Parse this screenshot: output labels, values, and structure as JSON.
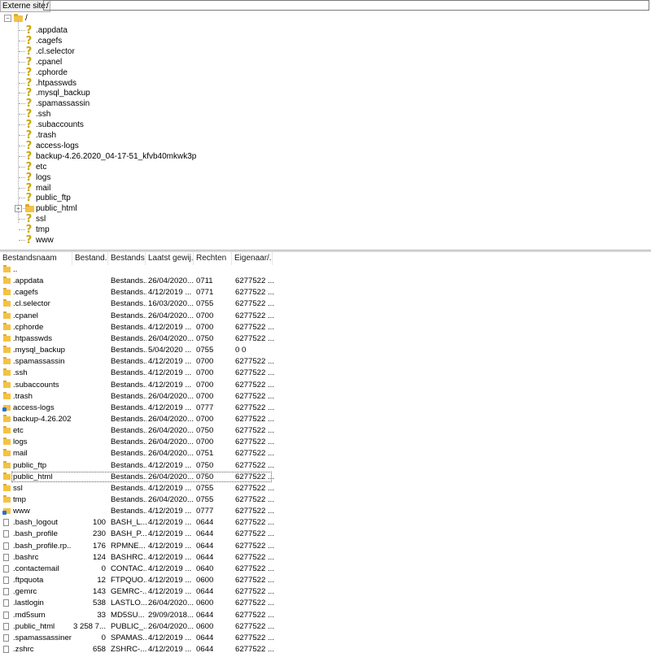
{
  "site_bar": {
    "label": "Externe site:",
    "path": "/"
  },
  "tree": {
    "root": "/",
    "items": [
      {
        "label": ".appdata",
        "icon": "unknown-folder-icon"
      },
      {
        "label": ".cagefs",
        "icon": "unknown-folder-icon"
      },
      {
        "label": ".cl.selector",
        "icon": "unknown-folder-icon"
      },
      {
        "label": ".cpanel",
        "icon": "unknown-folder-icon"
      },
      {
        "label": ".cphorde",
        "icon": "unknown-folder-icon"
      },
      {
        "label": ".htpasswds",
        "icon": "unknown-folder-icon"
      },
      {
        "label": ".mysql_backup",
        "icon": "unknown-folder-icon"
      },
      {
        "label": ".spamassassin",
        "icon": "unknown-folder-icon"
      },
      {
        "label": ".ssh",
        "icon": "unknown-folder-icon"
      },
      {
        "label": ".subaccounts",
        "icon": "unknown-folder-icon"
      },
      {
        "label": ".trash",
        "icon": "unknown-folder-icon"
      },
      {
        "label": "access-logs",
        "icon": "unknown-folder-icon"
      },
      {
        "label": "backup-4.26.2020_04-17-51_kfvb40mkwk3p",
        "icon": "unknown-folder-icon"
      },
      {
        "label": "etc",
        "icon": "unknown-folder-icon"
      },
      {
        "label": "logs",
        "icon": "unknown-folder-icon"
      },
      {
        "label": "mail",
        "icon": "unknown-folder-icon"
      },
      {
        "label": "public_ftp",
        "icon": "unknown-folder-icon"
      },
      {
        "label": "public_html",
        "icon": "folder-icon",
        "expandable": true
      },
      {
        "label": "ssl",
        "icon": "unknown-folder-icon"
      },
      {
        "label": "tmp",
        "icon": "unknown-folder-icon"
      },
      {
        "label": "www",
        "icon": "unknown-folder-icon"
      }
    ]
  },
  "list": {
    "columns": [
      "Bestandsnaam",
      "Bestand...",
      "Bestands...",
      "Laatst gewij...",
      "Rechten",
      "Eigenaar/..."
    ],
    "rows": [
      {
        "name": "..",
        "size": "",
        "type": "",
        "date": "",
        "perm": "",
        "owner": "",
        "icon": "folder"
      },
      {
        "name": ".appdata",
        "size": "",
        "type": "Bestands...",
        "date": "26/04/2020...",
        "perm": "0711",
        "owner": "6277522 ...",
        "icon": "folder"
      },
      {
        "name": ".cagefs",
        "size": "",
        "type": "Bestands...",
        "date": "4/12/2019 ...",
        "perm": "0771",
        "owner": "6277522 ...",
        "icon": "folder"
      },
      {
        "name": ".cl.selector",
        "size": "",
        "type": "Bestands...",
        "date": "16/03/2020...",
        "perm": "0755",
        "owner": "6277522 ...",
        "icon": "folder"
      },
      {
        "name": ".cpanel",
        "size": "",
        "type": "Bestands...",
        "date": "26/04/2020...",
        "perm": "0700",
        "owner": "6277522 ...",
        "icon": "folder"
      },
      {
        "name": ".cphorde",
        "size": "",
        "type": "Bestands...",
        "date": "4/12/2019 ...",
        "perm": "0700",
        "owner": "6277522 ...",
        "icon": "folder"
      },
      {
        "name": ".htpasswds",
        "size": "",
        "type": "Bestands...",
        "date": "26/04/2020...",
        "perm": "0750",
        "owner": "6277522 ...",
        "icon": "folder"
      },
      {
        "name": ".mysql_backup",
        "size": "",
        "type": "Bestands...",
        "date": "5/04/2020 ...",
        "perm": "0755",
        "owner": "0 0",
        "icon": "folder"
      },
      {
        "name": ".spamassassin",
        "size": "",
        "type": "Bestands...",
        "date": "4/12/2019 ...",
        "perm": "0700",
        "owner": "6277522 ...",
        "icon": "folder"
      },
      {
        "name": ".ssh",
        "size": "",
        "type": "Bestands...",
        "date": "4/12/2019 ...",
        "perm": "0700",
        "owner": "6277522 ...",
        "icon": "folder"
      },
      {
        "name": ".subaccounts",
        "size": "",
        "type": "Bestands...",
        "date": "4/12/2019 ...",
        "perm": "0700",
        "owner": "6277522 ...",
        "icon": "folder"
      },
      {
        "name": ".trash",
        "size": "",
        "type": "Bestands...",
        "date": "26/04/2020...",
        "perm": "0700",
        "owner": "6277522 ...",
        "icon": "folder"
      },
      {
        "name": "access-logs",
        "size": "",
        "type": "Bestands...",
        "date": "4/12/2019 ...",
        "perm": "0777",
        "owner": "6277522 ...",
        "icon": "link"
      },
      {
        "name": "backup-4.26.202...",
        "size": "",
        "type": "Bestands...",
        "date": "26/04/2020...",
        "perm": "0700",
        "owner": "6277522 ...",
        "icon": "folder"
      },
      {
        "name": "etc",
        "size": "",
        "type": "Bestands...",
        "date": "26/04/2020...",
        "perm": "0750",
        "owner": "6277522 ...",
        "icon": "folder"
      },
      {
        "name": "logs",
        "size": "",
        "type": "Bestands...",
        "date": "26/04/2020...",
        "perm": "0700",
        "owner": "6277522 ...",
        "icon": "folder"
      },
      {
        "name": "mail",
        "size": "",
        "type": "Bestands...",
        "date": "26/04/2020...",
        "perm": "0751",
        "owner": "6277522 ...",
        "icon": "folder"
      },
      {
        "name": "public_ftp",
        "size": "",
        "type": "Bestands...",
        "date": "4/12/2019 ...",
        "perm": "0750",
        "owner": "6277522 ...",
        "icon": "folder"
      },
      {
        "name": "public_html",
        "size": "",
        "type": "Bestands...",
        "date": "26/04/2020...",
        "perm": "0750",
        "owner": "6277522 ...",
        "icon": "folder",
        "selected": true
      },
      {
        "name": "ssl",
        "size": "",
        "type": "Bestands...",
        "date": "4/12/2019 ...",
        "perm": "0755",
        "owner": "6277522 ...",
        "icon": "folder"
      },
      {
        "name": "tmp",
        "size": "",
        "type": "Bestands...",
        "date": "26/04/2020...",
        "perm": "0755",
        "owner": "6277522 ...",
        "icon": "folder"
      },
      {
        "name": "www",
        "size": "",
        "type": "Bestands...",
        "date": "4/12/2019 ...",
        "perm": "0777",
        "owner": "6277522 ...",
        "icon": "link"
      },
      {
        "name": ".bash_logout",
        "size": "100",
        "type": "BASH_L...",
        "date": "4/12/2019 ...",
        "perm": "0644",
        "owner": "6277522 ...",
        "icon": "file"
      },
      {
        "name": ".bash_profile",
        "size": "230",
        "type": "BASH_P...",
        "date": "4/12/2019 ...",
        "perm": "0644",
        "owner": "6277522 ...",
        "icon": "file"
      },
      {
        "name": ".bash_profile.rp...",
        "size": "176",
        "type": "RPMNE...",
        "date": "4/12/2019 ...",
        "perm": "0644",
        "owner": "6277522 ...",
        "icon": "file"
      },
      {
        "name": ".bashrc",
        "size": "124",
        "type": "BASHRC...",
        "date": "4/12/2019 ...",
        "perm": "0644",
        "owner": "6277522 ...",
        "icon": "file"
      },
      {
        "name": ".contactemail",
        "size": "0",
        "type": "CONTAC...",
        "date": "4/12/2019 ...",
        "perm": "0640",
        "owner": "6277522 ...",
        "icon": "file"
      },
      {
        "name": ".ftpquota",
        "size": "12",
        "type": "FTPQUO...",
        "date": "4/12/2019 ...",
        "perm": "0600",
        "owner": "6277522 ...",
        "icon": "file"
      },
      {
        "name": ".gemrc",
        "size": "143",
        "type": "GEMRC-...",
        "date": "4/12/2019 ...",
        "perm": "0644",
        "owner": "6277522 ...",
        "icon": "file"
      },
      {
        "name": ".lastlogin",
        "size": "538",
        "type": "LASTLO...",
        "date": "26/04/2020...",
        "perm": "0600",
        "owner": "6277522 ...",
        "icon": "file"
      },
      {
        "name": ".md5sum",
        "size": "33",
        "type": "MD5SU...",
        "date": "29/09/2018...",
        "perm": "0644",
        "owner": "6277522 ...",
        "icon": "file"
      },
      {
        "name": ".public_html",
        "size": "3 258 7...",
        "type": "PUBLIC_...",
        "date": "26/04/2020...",
        "perm": "0600",
        "owner": "6277522 ...",
        "icon": "file"
      },
      {
        "name": ".spamassassinen...",
        "size": "0",
        "type": "SPAMAS...",
        "date": "4/12/2019 ...",
        "perm": "0644",
        "owner": "6277522 ...",
        "icon": "file"
      },
      {
        "name": ".zshrc",
        "size": "658",
        "type": "ZSHRC-...",
        "date": "4/12/2019 ...",
        "perm": "0644",
        "owner": "6277522 ...",
        "icon": "file"
      }
    ]
  }
}
